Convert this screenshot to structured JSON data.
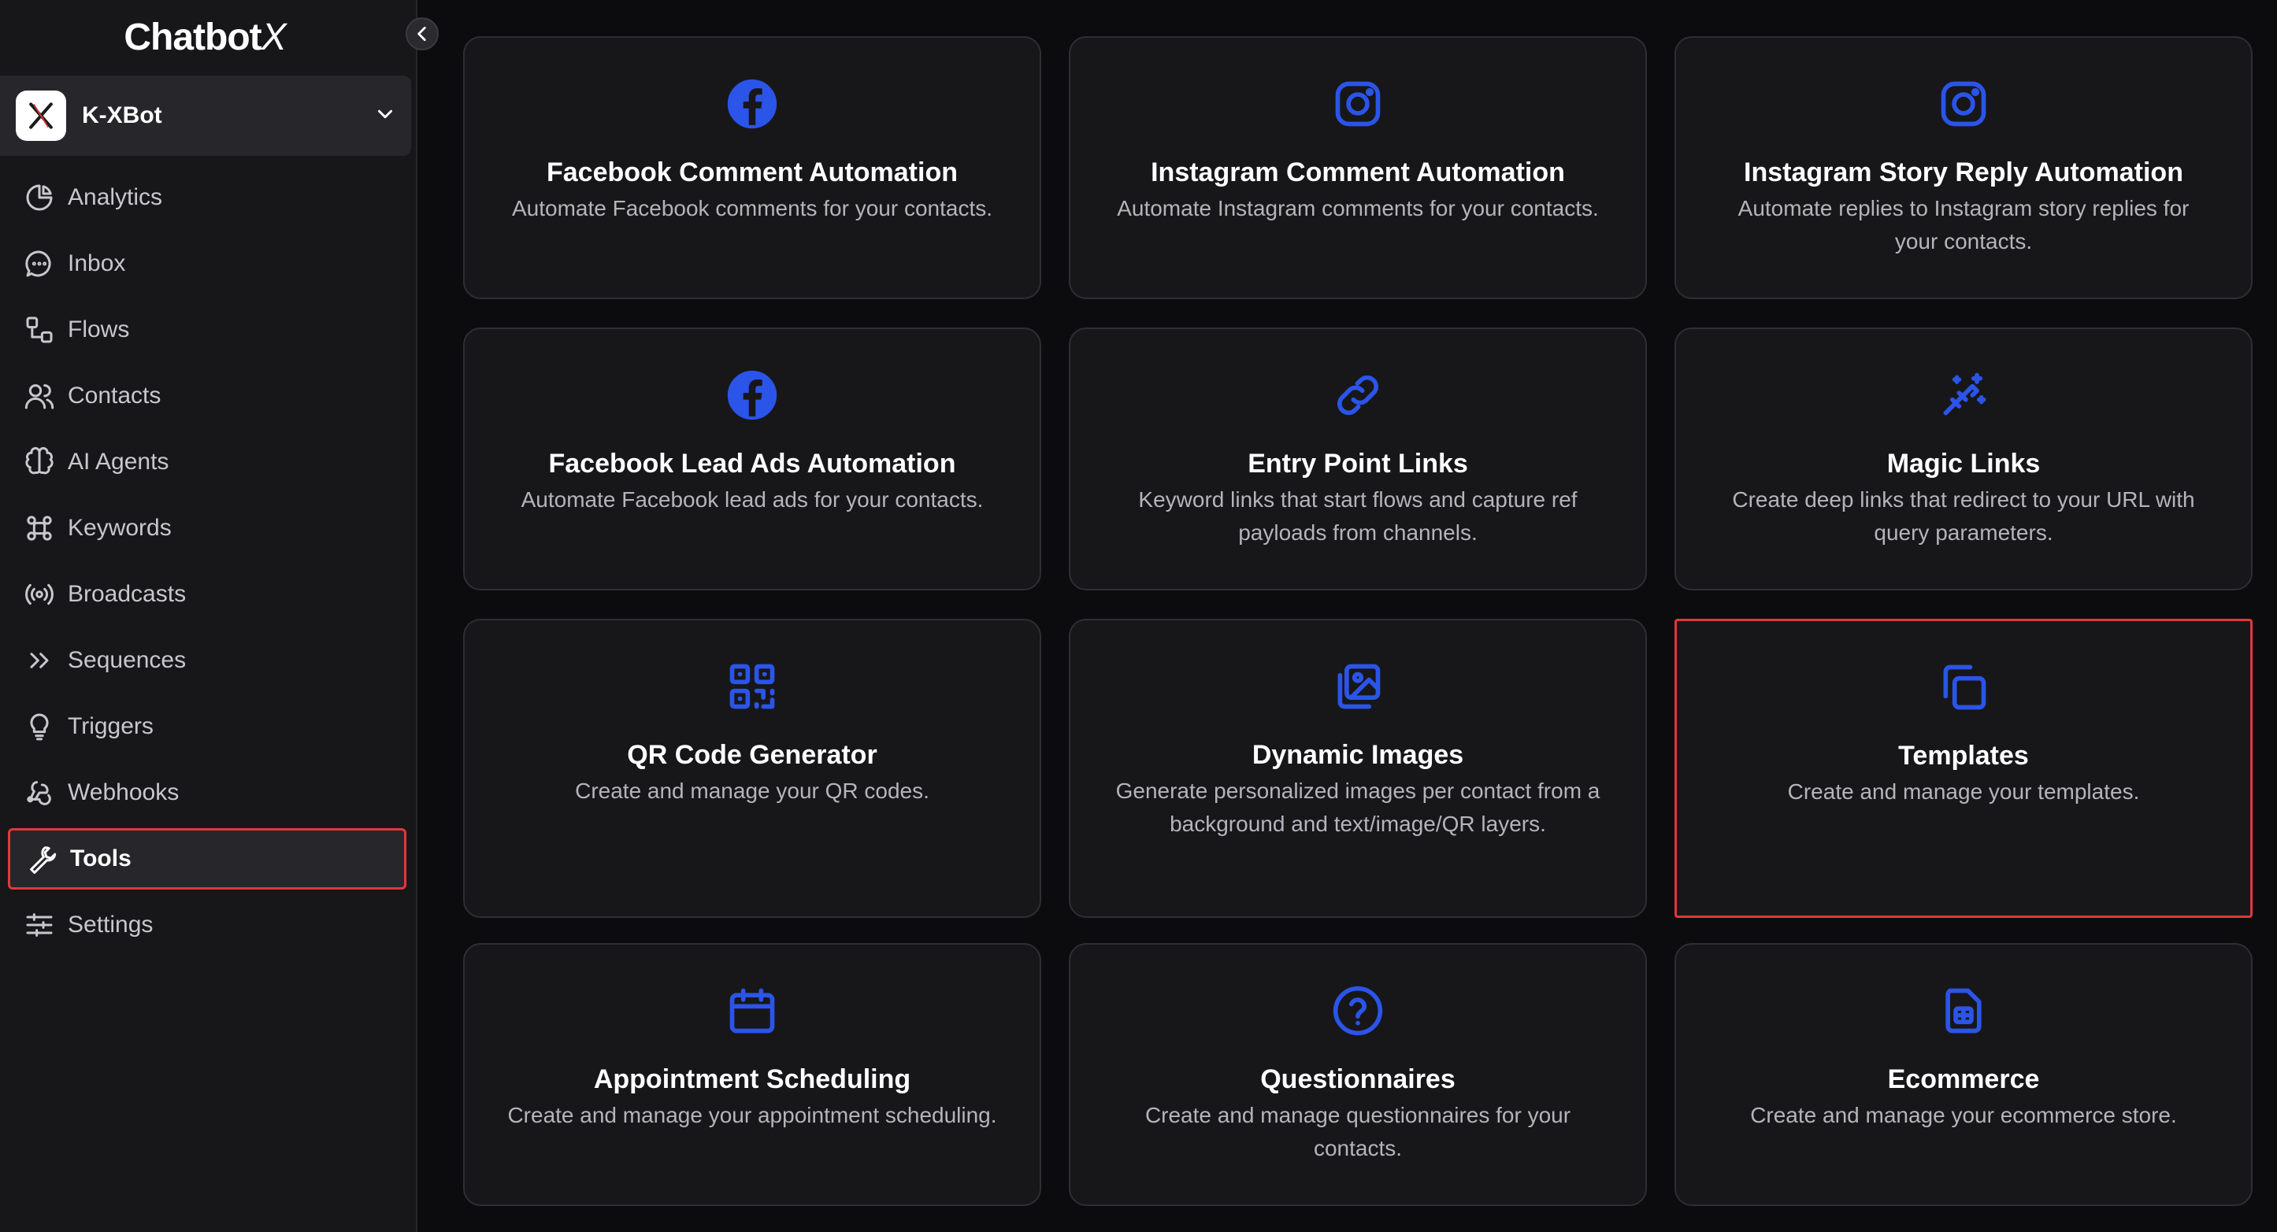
{
  "brand": {
    "name_main": "Chatbot",
    "name_x": "X"
  },
  "bot": {
    "name": "K-XBot"
  },
  "nav": [
    {
      "label": "Analytics",
      "icon": "pie-chart-icon"
    },
    {
      "label": "Inbox",
      "icon": "chat-bubble-icon"
    },
    {
      "label": "Flows",
      "icon": "flow-icon"
    },
    {
      "label": "Contacts",
      "icon": "users-icon"
    },
    {
      "label": "AI Agents",
      "icon": "brain-icon"
    },
    {
      "label": "Keywords",
      "icon": "keywords-icon"
    },
    {
      "label": "Broadcasts",
      "icon": "broadcast-icon"
    },
    {
      "label": "Sequences",
      "icon": "double-chevron-icon"
    },
    {
      "label": "Triggers",
      "icon": "lightbulb-icon"
    },
    {
      "label": "Webhooks",
      "icon": "webhook-icon"
    },
    {
      "label": "Tools",
      "icon": "wrench-icon",
      "active": true
    },
    {
      "label": "Settings",
      "icon": "sliders-icon"
    }
  ],
  "cards": [
    {
      "title": "Facebook Comment Automation",
      "desc": "Automate Facebook comments for your contacts.",
      "icon": "facebook-icon"
    },
    {
      "title": "Instagram Comment Automation",
      "desc": "Automate Instagram comments for your contacts.",
      "icon": "instagram-icon"
    },
    {
      "title": "Instagram Story Reply Automation",
      "desc": "Automate replies to Instagram story replies for your contacts.",
      "icon": "instagram-icon"
    },
    {
      "title": "Facebook Lead Ads Automation",
      "desc": "Automate Facebook lead ads for your contacts.",
      "icon": "facebook-icon"
    },
    {
      "title": "Entry Point Links",
      "desc": "Keyword links that start flows and capture ref payloads from channels.",
      "icon": "link-icon"
    },
    {
      "title": "Magic Links",
      "desc": "Create deep links that redirect to your URL with query parameters.",
      "icon": "magic-wand-icon"
    },
    {
      "title": "QR Code Generator",
      "desc": "Create and manage your QR codes.",
      "icon": "qr-code-icon"
    },
    {
      "title": "Dynamic Images",
      "desc": "Generate personalized images per contact from a background and text/image/QR layers.",
      "icon": "images-icon"
    },
    {
      "title": "Templates",
      "desc": "Create and manage your templates.",
      "icon": "copy-icon",
      "highlight": true
    },
    {
      "title": "Appointment Scheduling",
      "desc": "Create and manage your appointment scheduling.",
      "icon": "calendar-icon"
    },
    {
      "title": "Questionnaires",
      "desc": "Create and manage questionnaires for your contacts.",
      "icon": "question-icon"
    },
    {
      "title": "Ecommerce",
      "desc": "Create and manage your ecommerce store.",
      "icon": "store-icon"
    }
  ],
  "colors": {
    "accent": "#2b54e8",
    "highlight": "#e0383b",
    "background": "#0c0c0e",
    "panel": "#17171a"
  }
}
